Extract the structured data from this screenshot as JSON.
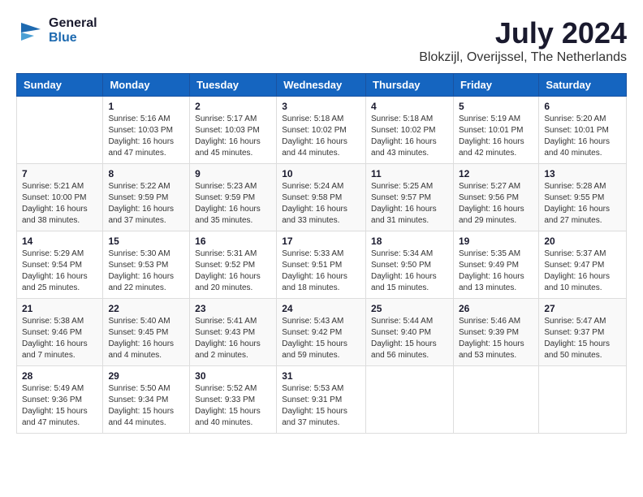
{
  "header": {
    "logo_line1": "General",
    "logo_line2": "Blue",
    "month": "July 2024",
    "location": "Blokzijl, Overijssel, The Netherlands"
  },
  "weekdays": [
    "Sunday",
    "Monday",
    "Tuesday",
    "Wednesday",
    "Thursday",
    "Friday",
    "Saturday"
  ],
  "weeks": [
    [
      {
        "day": "",
        "info": ""
      },
      {
        "day": "1",
        "info": "Sunrise: 5:16 AM\nSunset: 10:03 PM\nDaylight: 16 hours\nand 47 minutes."
      },
      {
        "day": "2",
        "info": "Sunrise: 5:17 AM\nSunset: 10:03 PM\nDaylight: 16 hours\nand 45 minutes."
      },
      {
        "day": "3",
        "info": "Sunrise: 5:18 AM\nSunset: 10:02 PM\nDaylight: 16 hours\nand 44 minutes."
      },
      {
        "day": "4",
        "info": "Sunrise: 5:18 AM\nSunset: 10:02 PM\nDaylight: 16 hours\nand 43 minutes."
      },
      {
        "day": "5",
        "info": "Sunrise: 5:19 AM\nSunset: 10:01 PM\nDaylight: 16 hours\nand 42 minutes."
      },
      {
        "day": "6",
        "info": "Sunrise: 5:20 AM\nSunset: 10:01 PM\nDaylight: 16 hours\nand 40 minutes."
      }
    ],
    [
      {
        "day": "7",
        "info": "Sunrise: 5:21 AM\nSunset: 10:00 PM\nDaylight: 16 hours\nand 38 minutes."
      },
      {
        "day": "8",
        "info": "Sunrise: 5:22 AM\nSunset: 9:59 PM\nDaylight: 16 hours\nand 37 minutes."
      },
      {
        "day": "9",
        "info": "Sunrise: 5:23 AM\nSunset: 9:59 PM\nDaylight: 16 hours\nand 35 minutes."
      },
      {
        "day": "10",
        "info": "Sunrise: 5:24 AM\nSunset: 9:58 PM\nDaylight: 16 hours\nand 33 minutes."
      },
      {
        "day": "11",
        "info": "Sunrise: 5:25 AM\nSunset: 9:57 PM\nDaylight: 16 hours\nand 31 minutes."
      },
      {
        "day": "12",
        "info": "Sunrise: 5:27 AM\nSunset: 9:56 PM\nDaylight: 16 hours\nand 29 minutes."
      },
      {
        "day": "13",
        "info": "Sunrise: 5:28 AM\nSunset: 9:55 PM\nDaylight: 16 hours\nand 27 minutes."
      }
    ],
    [
      {
        "day": "14",
        "info": "Sunrise: 5:29 AM\nSunset: 9:54 PM\nDaylight: 16 hours\nand 25 minutes."
      },
      {
        "day": "15",
        "info": "Sunrise: 5:30 AM\nSunset: 9:53 PM\nDaylight: 16 hours\nand 22 minutes."
      },
      {
        "day": "16",
        "info": "Sunrise: 5:31 AM\nSunset: 9:52 PM\nDaylight: 16 hours\nand 20 minutes."
      },
      {
        "day": "17",
        "info": "Sunrise: 5:33 AM\nSunset: 9:51 PM\nDaylight: 16 hours\nand 18 minutes."
      },
      {
        "day": "18",
        "info": "Sunrise: 5:34 AM\nSunset: 9:50 PM\nDaylight: 16 hours\nand 15 minutes."
      },
      {
        "day": "19",
        "info": "Sunrise: 5:35 AM\nSunset: 9:49 PM\nDaylight: 16 hours\nand 13 minutes."
      },
      {
        "day": "20",
        "info": "Sunrise: 5:37 AM\nSunset: 9:47 PM\nDaylight: 16 hours\nand 10 minutes."
      }
    ],
    [
      {
        "day": "21",
        "info": "Sunrise: 5:38 AM\nSunset: 9:46 PM\nDaylight: 16 hours\nand 7 minutes."
      },
      {
        "day": "22",
        "info": "Sunrise: 5:40 AM\nSunset: 9:45 PM\nDaylight: 16 hours\nand 4 minutes."
      },
      {
        "day": "23",
        "info": "Sunrise: 5:41 AM\nSunset: 9:43 PM\nDaylight: 16 hours\nand 2 minutes."
      },
      {
        "day": "24",
        "info": "Sunrise: 5:43 AM\nSunset: 9:42 PM\nDaylight: 15 hours\nand 59 minutes."
      },
      {
        "day": "25",
        "info": "Sunrise: 5:44 AM\nSunset: 9:40 PM\nDaylight: 15 hours\nand 56 minutes."
      },
      {
        "day": "26",
        "info": "Sunrise: 5:46 AM\nSunset: 9:39 PM\nDaylight: 15 hours\nand 53 minutes."
      },
      {
        "day": "27",
        "info": "Sunrise: 5:47 AM\nSunset: 9:37 PM\nDaylight: 15 hours\nand 50 minutes."
      }
    ],
    [
      {
        "day": "28",
        "info": "Sunrise: 5:49 AM\nSunset: 9:36 PM\nDaylight: 15 hours\nand 47 minutes."
      },
      {
        "day": "29",
        "info": "Sunrise: 5:50 AM\nSunset: 9:34 PM\nDaylight: 15 hours\nand 44 minutes."
      },
      {
        "day": "30",
        "info": "Sunrise: 5:52 AM\nSunset: 9:33 PM\nDaylight: 15 hours\nand 40 minutes."
      },
      {
        "day": "31",
        "info": "Sunrise: 5:53 AM\nSunset: 9:31 PM\nDaylight: 15 hours\nand 37 minutes."
      },
      {
        "day": "",
        "info": ""
      },
      {
        "day": "",
        "info": ""
      },
      {
        "day": "",
        "info": ""
      }
    ]
  ]
}
